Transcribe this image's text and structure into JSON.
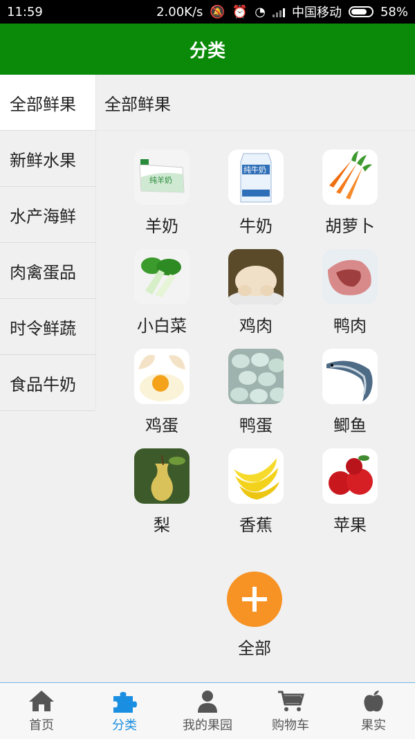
{
  "status": {
    "time": "11:59",
    "speed": "2.00K/s",
    "carrier": "中国移动",
    "battery": "58%"
  },
  "header": {
    "title": "分类"
  },
  "sidebar": {
    "items": [
      {
        "label": "全部鲜果"
      },
      {
        "label": "新鲜水果"
      },
      {
        "label": "水产海鲜"
      },
      {
        "label": "肉禽蛋品"
      },
      {
        "label": "时令鲜蔬"
      },
      {
        "label": "食品牛奶"
      }
    ]
  },
  "content": {
    "title": "全部鲜果",
    "products": [
      {
        "label": "羊奶",
        "icon": "goat-milk-pack"
      },
      {
        "label": "牛奶",
        "icon": "milk-carton"
      },
      {
        "label": "胡萝卜",
        "icon": "carrots"
      },
      {
        "label": "小白菜",
        "icon": "bok-choy"
      },
      {
        "label": "鸡肉",
        "icon": "chicken"
      },
      {
        "label": "鸭肉",
        "icon": "duck-meat"
      },
      {
        "label": "鸡蛋",
        "icon": "egg"
      },
      {
        "label": "鸭蛋",
        "icon": "duck-eggs"
      },
      {
        "label": "鲫鱼",
        "icon": "fish"
      },
      {
        "label": "梨",
        "icon": "pear"
      },
      {
        "label": "香蕉",
        "icon": "bananas"
      },
      {
        "label": "苹果",
        "icon": "apples"
      }
    ],
    "all_button": {
      "label": "全部"
    },
    "milk_pack_text": "纯羊奶",
    "milk_carton_text": "纯牛奶"
  },
  "tabbar": {
    "items": [
      {
        "label": "首页",
        "icon": "home-icon"
      },
      {
        "label": "分类",
        "icon": "puzzle-icon"
      },
      {
        "label": "我的果园",
        "icon": "user-icon"
      },
      {
        "label": "购物车",
        "icon": "cart-icon"
      },
      {
        "label": "果实",
        "icon": "apple-icon"
      }
    ]
  },
  "colors": {
    "header_bg": "#0a8a08",
    "accent": "#1a8ee0",
    "all_button": "#f79224"
  }
}
